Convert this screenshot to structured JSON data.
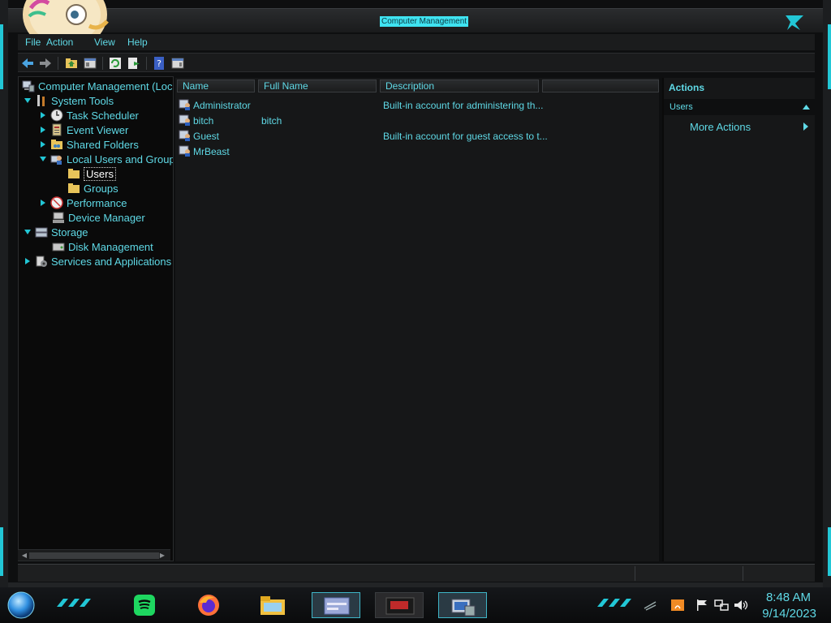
{
  "window": {
    "title": "Computer Management"
  },
  "menu": {
    "file": "File",
    "action": "Action",
    "view": "View",
    "help": "Help"
  },
  "toolbar": {
    "icons": [
      "back-arrow-icon",
      "forward-arrow-icon",
      "up-folder-icon",
      "show-hide-console-tree-icon",
      "refresh-icon",
      "export-list-icon",
      "help-icon",
      "show-hide-action-pane-icon"
    ]
  },
  "tree": {
    "root": "Computer Management (Local)",
    "system_tools": "System Tools",
    "task_scheduler": "Task Scheduler",
    "event_viewer": "Event Viewer",
    "shared_folders": "Shared Folders",
    "local_users_groups": "Local Users and Groups",
    "users": "Users",
    "groups": "Groups",
    "performance": "Performance",
    "device_manager": "Device Manager",
    "storage": "Storage",
    "disk_management": "Disk Management",
    "services_apps": "Services and Applications"
  },
  "list": {
    "columns": [
      "Name",
      "Full Name",
      "Description",
      ""
    ],
    "rows": [
      {
        "name": "Administrator",
        "full_name": "",
        "description": "Built-in account for administering th..."
      },
      {
        "name": "bitch",
        "full_name": "bitch",
        "description": ""
      },
      {
        "name": "Guest",
        "full_name": "",
        "description": "Built-in account for guest access to t..."
      },
      {
        "name": "MrBeast",
        "full_name": "",
        "description": ""
      }
    ]
  },
  "actions": {
    "title": "Actions",
    "section": "Users",
    "more_actions": "More Actions"
  },
  "taskbar": {
    "apps": [
      "spotify-icon",
      "firefox-icon",
      "file-explorer-icon",
      "control-panel-icon",
      "media-app-icon",
      "computer-management-icon"
    ],
    "time": "8:48 AM",
    "date": "9/14/2023"
  },
  "colors": {
    "accent": "#5fd9e6",
    "background": "#161718",
    "tree_background": "#0a0a0a"
  }
}
